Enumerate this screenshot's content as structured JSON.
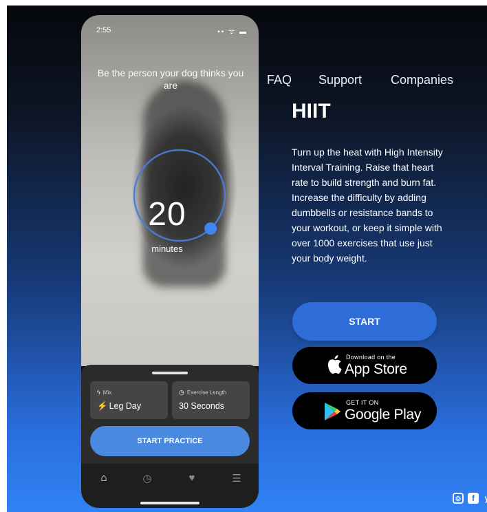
{
  "phone": {
    "status_time": "2:55",
    "status_icons": "▪▪ ᯤ ▬",
    "tagline": "Be the person your dog thinks you are",
    "timer": {
      "value": "20",
      "unit": "minutes",
      "progress": 0.38
    },
    "options": [
      {
        "label": "Mix",
        "icon": "lightning-icon",
        "value": "Leg Day"
      },
      {
        "label": "Exercise Length",
        "icon": "clock-icon",
        "value": "30 Seconds"
      }
    ],
    "start_practice_label": "START PRACTICE",
    "tabs": [
      {
        "name": "home",
        "icon": "home-icon",
        "glyph": "⌂"
      },
      {
        "name": "history",
        "icon": "history-icon",
        "glyph": "◷"
      },
      {
        "name": "favorites",
        "icon": "heart-icon",
        "glyph": "♥"
      },
      {
        "name": "menu",
        "icon": "menu-icon",
        "glyph": "☰"
      }
    ]
  },
  "nav": {
    "faq": "FAQ",
    "support": "Support",
    "companies": "Companies"
  },
  "hero": {
    "title": "HIIT",
    "description": "Turn up the heat with High Intensity Interval Training. Raise that heart rate to build strength and burn fat. Increase the difficulty by adding dumbbells or resistance bands to your workout, or keep it simple with over 1000 exercises that use just your body weight.",
    "start_label": "START"
  },
  "stores": {
    "apple": {
      "small": "Download on the",
      "big": "App Store"
    },
    "google": {
      "small": "GET IT ON",
      "big": "Google Play"
    }
  },
  "social": {
    "instagram": "◎",
    "facebook": "f",
    "twitter": "y"
  },
  "colors": {
    "accent": "#4a89e0",
    "start": "#2e6cd7",
    "gradient_bottom": "#3182f4"
  }
}
